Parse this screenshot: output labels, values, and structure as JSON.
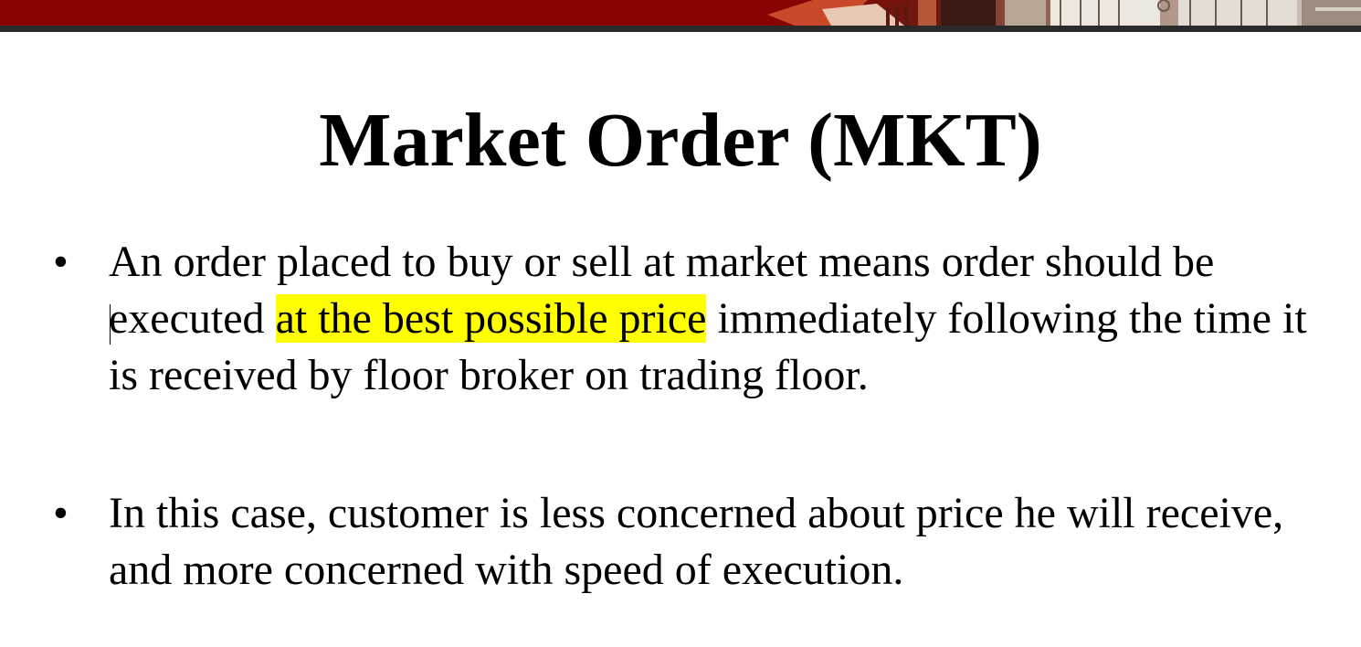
{
  "slide": {
    "title": "Market Order (MKT)",
    "bullets": [
      {
        "marker": "•",
        "before_highlight": "An order placed to buy or sell at market means order should be executed ",
        "highlight": "at the best possible price",
        "after_highlight": " immediately following the time it is received by floor broker on trading floor."
      },
      {
        "marker": "•",
        "text": "In this case, customer is less concerned about price he will receive, and more concerned with speed of execution."
      }
    ],
    "colors": {
      "header_band": "#8b0000",
      "header_rule": "#2a2a2a",
      "highlight": "#ffff00"
    }
  }
}
